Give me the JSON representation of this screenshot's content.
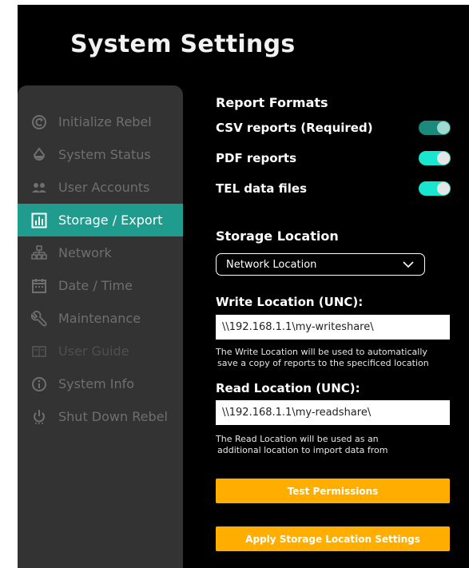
{
  "page": {
    "title": "System Settings"
  },
  "sidebar": {
    "items": [
      {
        "label": "Initialize Rebel",
        "icon": "refresh-c-icon",
        "state": "normal"
      },
      {
        "label": "System Status",
        "icon": "droplet-icon",
        "state": "normal"
      },
      {
        "label": "User Accounts",
        "icon": "users-icon",
        "state": "normal"
      },
      {
        "label": "Storage / Export",
        "icon": "bar-chart-icon",
        "state": "active"
      },
      {
        "label": "Network",
        "icon": "network-icon",
        "state": "normal"
      },
      {
        "label": "Date / Time",
        "icon": "calendar-icon",
        "state": "normal"
      },
      {
        "label": "Maintenance",
        "icon": "wrench-icon",
        "state": "normal"
      },
      {
        "label": "User Guide",
        "icon": "book-icon",
        "state": "disabled"
      },
      {
        "label": "System Info",
        "icon": "info-icon",
        "state": "normal"
      },
      {
        "label": "Shut Down Rebel",
        "icon": "power-icon",
        "state": "normal"
      }
    ]
  },
  "report_formats": {
    "title": "Report Formats",
    "items": [
      {
        "label": "CSV reports (Required)",
        "enabled": true,
        "locked": true
      },
      {
        "label": "PDF reports",
        "enabled": true,
        "locked": false
      },
      {
        "label": "TEL data files",
        "enabled": true,
        "locked": false
      }
    ]
  },
  "storage_location": {
    "title": "Storage Location",
    "selected": "Network Location",
    "write": {
      "label": "Write Location (UNC):",
      "value": "\\\\192.168.1.1\\my-writeshare\\",
      "help_line1": "The Write Location will be used to automatically",
      "help_line2": "save a copy of reports to the specificed location"
    },
    "read": {
      "label": "Read Location (UNC):",
      "value": "\\\\192.168.1.1\\my-readshare\\",
      "help_line1": "The Read Location will be used as an",
      "help_line2": "additional location to import data from"
    }
  },
  "buttons": {
    "test": "Test Permissions",
    "apply": "Apply Storage Location Settings"
  },
  "colors": {
    "accent": "#1f9c8e",
    "toggle_on": "#19e6cf",
    "button": "#ffae00",
    "sidebar_bg": "#333333",
    "background": "#000000"
  }
}
